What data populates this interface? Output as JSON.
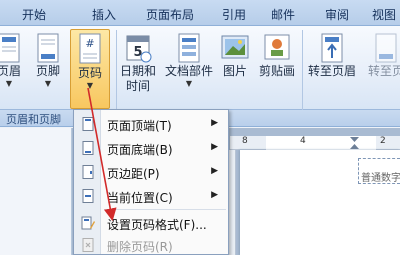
{
  "tabs": [
    "开始",
    "插入",
    "页面布局",
    "引用",
    "邮件",
    "审阅",
    "视图"
  ],
  "ribbon": {
    "buttons": {
      "header": "页眉",
      "footer": "页脚",
      "page_number": "页码",
      "date_time_line1": "日期和",
      "date_time_line2": "时间",
      "doc_parts": "文档部件",
      "picture": "图片",
      "clip_art": "剪贴画",
      "goto_header": "转至页眉",
      "goto_footer": "转至页"
    },
    "group_label": "页眉和页脚",
    "page_number_icon_glyph": "#",
    "date_icon_glyph": "5"
  },
  "menu": {
    "items": [
      {
        "label": "页面顶端(T)",
        "submenu": "▶"
      },
      {
        "label": "页面底端(B)",
        "submenu": "▶"
      },
      {
        "label": "页边距(P)",
        "submenu": "▶"
      },
      {
        "label": "当前位置(C)",
        "submenu": "▶"
      },
      {
        "label": "设置页码格式(F)..."
      },
      {
        "label": "删除页码(R)"
      }
    ]
  },
  "document": {
    "ruler_numbers": [
      "8",
      "4",
      "2"
    ],
    "header_hint": "普通数字"
  },
  "colors": {
    "accent": "#f8c760",
    "annotation": "#d22a2a"
  }
}
